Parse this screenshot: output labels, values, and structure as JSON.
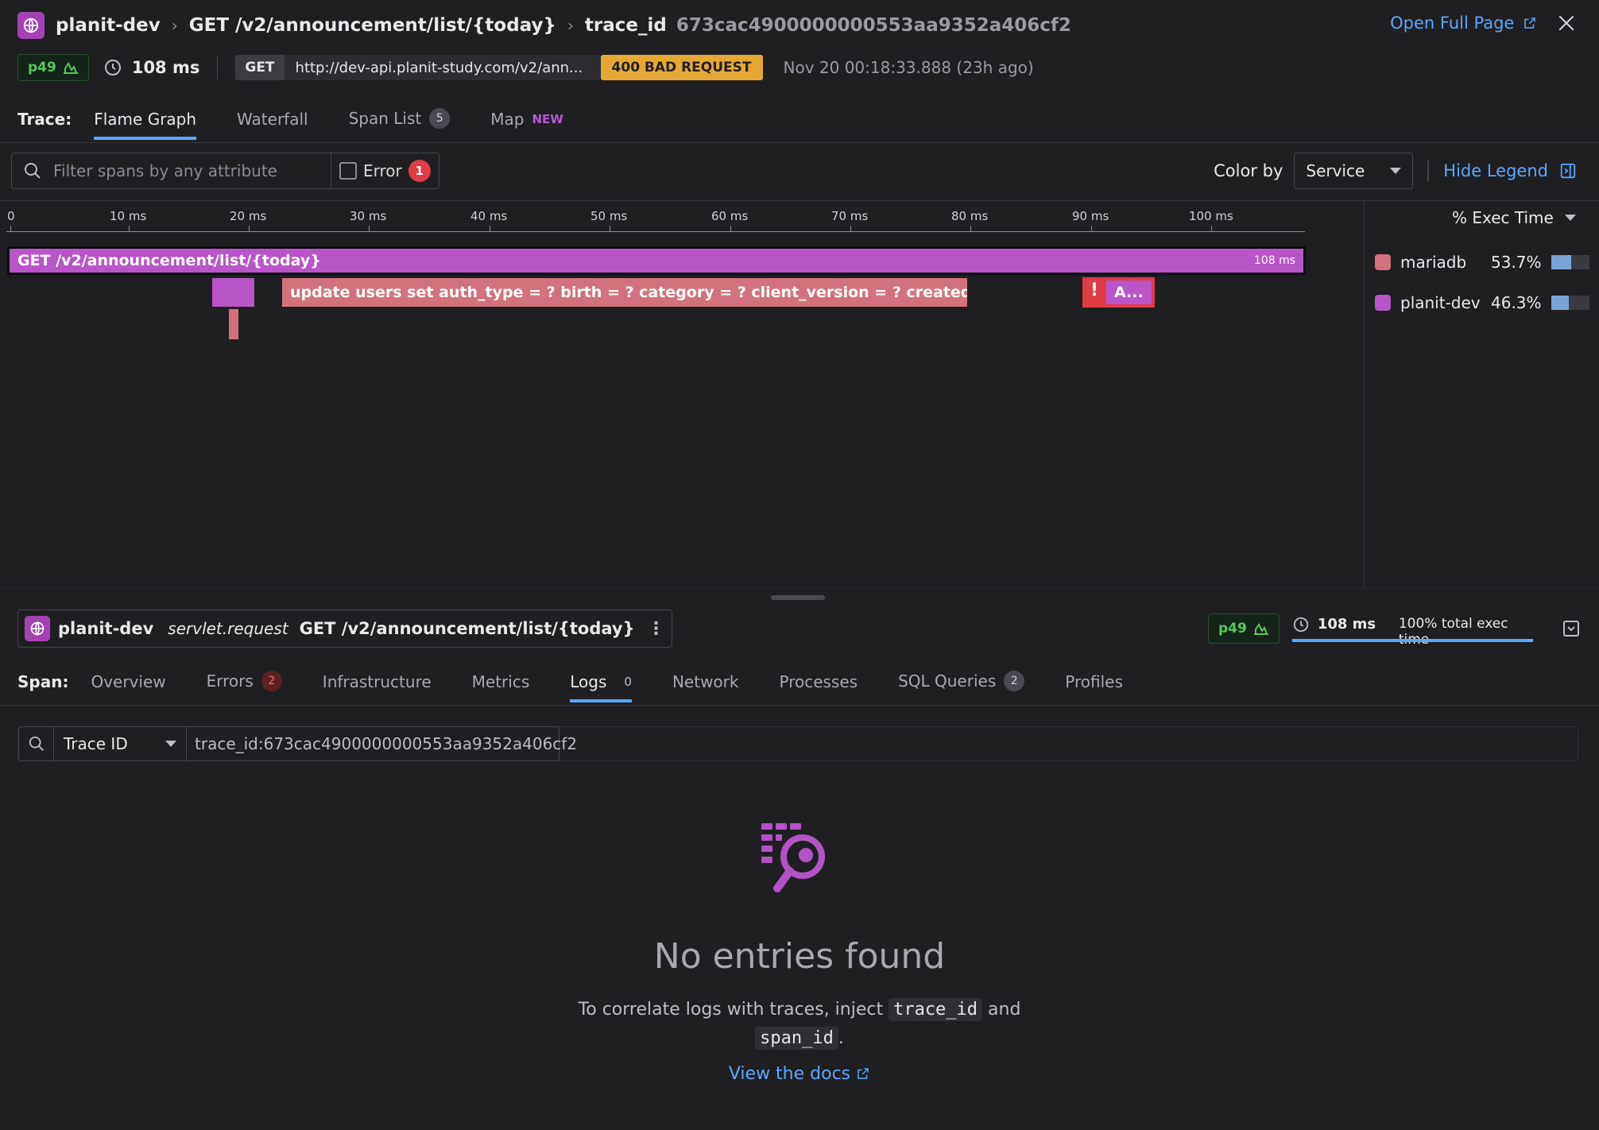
{
  "header": {
    "service": "planit-dev",
    "resource": "GET /v2/announcement/list/{today}",
    "trace_label": "trace_id",
    "trace_id": "673cac4900000000553aa9352a406cf2",
    "open_full_page": "Open Full Page"
  },
  "summary": {
    "percentile": "p49",
    "duration": "108 ms",
    "method": "GET",
    "url": "http://dev-api.planit-study.com/v2/ann...",
    "status": "400 BAD REQUEST",
    "timestamp": "Nov 20 00:18:33.888 (23h ago)"
  },
  "trace_tabs": {
    "label": "Trace:",
    "items": [
      {
        "label": "Flame Graph",
        "active": true
      },
      {
        "label": "Waterfall"
      },
      {
        "label": "Span List",
        "count": "5"
      },
      {
        "label": "Map",
        "tag": "NEW"
      }
    ]
  },
  "filter": {
    "placeholder": "Filter spans by any attribute",
    "error_label": "Error",
    "error_count": "1",
    "color_by_label": "Color by",
    "color_by_value": "Service",
    "hide_legend": "Hide Legend"
  },
  "ruler": [
    "0",
    "10 ms",
    "20 ms",
    "30 ms",
    "40 ms",
    "50 ms",
    "60 ms",
    "70 ms",
    "80 ms",
    "90 ms",
    "100 ms"
  ],
  "flame": {
    "root_label": "GET /v2/announcement/list/{today}",
    "root_duration": "108 ms",
    "sql_label": "update users set auth_type = ? birth = ? category = ? client_version = ? created_a...",
    "error_span_label": "A...",
    "error_mark": "!"
  },
  "legend": {
    "header": "% Exec Time",
    "items": [
      {
        "name": "mariadb",
        "pct": "53.7%",
        "fraction": 0.537,
        "color": "#d3727c"
      },
      {
        "name": "planit-dev",
        "pct": "46.3%",
        "fraction": 0.463,
        "color": "#b954c9"
      }
    ]
  },
  "span": {
    "service": "planit-dev",
    "operation": "servlet.request",
    "resource": "GET /v2/announcement/list/{today}",
    "percentile": "p49",
    "duration": "108 ms",
    "exec_time": "100% total exec time"
  },
  "span_tabs": {
    "label": "Span:",
    "items": [
      {
        "label": "Overview"
      },
      {
        "label": "Errors",
        "count": "2"
      },
      {
        "label": "Infrastructure"
      },
      {
        "label": "Metrics"
      },
      {
        "label": "Logs",
        "count": "0",
        "active": true
      },
      {
        "label": "Network"
      },
      {
        "label": "Processes"
      },
      {
        "label": "SQL Queries",
        "count": "2"
      },
      {
        "label": "Profiles"
      }
    ]
  },
  "logs": {
    "field": "Trace ID",
    "query": "trace_id:673cac4900000000553aa9352a406cf2",
    "empty_title": "No entries found",
    "hint_prefix": "To correlate logs with traces, inject",
    "hint_code1": "trace_id",
    "hint_and": "and",
    "hint_code2": "span_id",
    "hint_suffix": ".",
    "docs_link": "View the docs"
  },
  "colors": {
    "accent": "#5aa7ff",
    "service": "#a442b3",
    "db": "#d3727c",
    "error": "#e03c46",
    "status_warn": "#e6a835"
  }
}
